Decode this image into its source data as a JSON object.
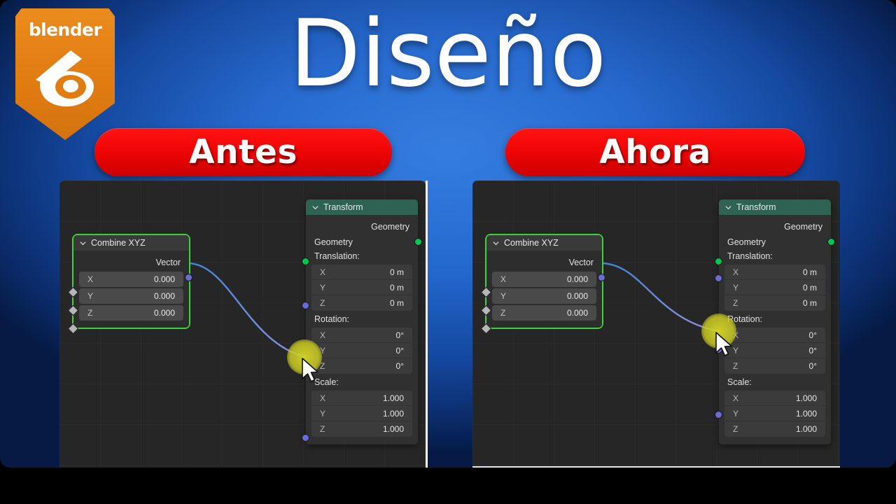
{
  "thumbnail": {
    "brand": "blender",
    "title": "Diseño",
    "background_color": "#1b62cc",
    "accent_color": "#f20606",
    "logo_color": "#e07c12"
  },
  "badges": {
    "left": "Antes",
    "right": "Ahora"
  },
  "panels": [
    {
      "id": "antes",
      "variant": "Antes",
      "nodes": {
        "combine_xyz": {
          "title": "Combine XYZ",
          "collapse_icon": "chevron-down-icon",
          "selected": true,
          "output": {
            "label": "Vector",
            "socket": "vector-socket",
            "color": "#6b6bd6"
          },
          "inputs": [
            {
              "key": "X",
              "value": "0.000",
              "socket": "diamond-socket"
            },
            {
              "key": "Y",
              "value": "0.000",
              "socket": "diamond-socket"
            },
            {
              "key": "Z",
              "value": "0.000",
              "socket": "diamond-socket"
            }
          ]
        },
        "transform": {
          "title": "Transform",
          "collapse_icon": "chevron-down-icon",
          "header_color": "#2e6353",
          "output": {
            "label": "Geometry",
            "socket": "geometry-socket",
            "color": "#00c64f"
          },
          "input_geometry": {
            "label": "Geometry",
            "socket": "geometry-socket",
            "color": "#00c64f"
          },
          "groups": [
            {
              "label": "Translation:",
              "socket_aligned_to_label": false,
              "fields": [
                {
                  "key": "X",
                  "value": "0 m"
                },
                {
                  "key": "Y",
                  "value": "0 m"
                },
                {
                  "key": "Z",
                  "value": "0 m"
                }
              ]
            },
            {
              "label": "Rotation:",
              "socket_aligned_to_label": false,
              "fields": [
                {
                  "key": "X",
                  "value": "0°"
                },
                {
                  "key": "Y",
                  "value": "0°"
                },
                {
                  "key": "Z",
                  "value": "0°"
                }
              ]
            },
            {
              "label": "Scale:",
              "socket_aligned_to_label": false,
              "fields": [
                {
                  "key": "X",
                  "value": "1.000"
                },
                {
                  "key": "Y",
                  "value": "1.000"
                },
                {
                  "key": "Z",
                  "value": "1.000"
                }
              ]
            }
          ]
        }
      },
      "link": {
        "from": "Vector",
        "to": "Rotation",
        "color_start": "#3f86d8",
        "color_end": "#8f8fd8"
      },
      "cursor": {
        "icon": "mouse-pointer-icon",
        "highlight_color": "#d6d628"
      }
    },
    {
      "id": "ahora",
      "variant": "Ahora",
      "nodes": {
        "combine_xyz": {
          "title": "Combine XYZ",
          "collapse_icon": "chevron-down-icon",
          "selected": true,
          "output": {
            "label": "Vector",
            "socket": "vector-socket",
            "color": "#6b6bd6"
          },
          "inputs": [
            {
              "key": "X",
              "value": "0.000",
              "socket": "diamond-socket"
            },
            {
              "key": "Y",
              "value": "0.000",
              "socket": "diamond-socket"
            },
            {
              "key": "Z",
              "value": "0.000",
              "socket": "diamond-socket"
            }
          ]
        },
        "transform": {
          "title": "Transform",
          "collapse_icon": "chevron-down-icon",
          "header_color": "#2e6353",
          "output": {
            "label": "Geometry",
            "socket": "geometry-socket",
            "color": "#00c64f"
          },
          "input_geometry": {
            "label": "Geometry",
            "socket": "geometry-socket",
            "color": "#00c64f"
          },
          "groups": [
            {
              "label": "Translation:",
              "socket_aligned_to_label": true,
              "fields": [
                {
                  "key": "X",
                  "value": "0 m"
                },
                {
                  "key": "Y",
                  "value": "0 m"
                },
                {
                  "key": "Z",
                  "value": "0 m"
                }
              ]
            },
            {
              "label": "Rotation:",
              "socket_aligned_to_label": true,
              "fields": [
                {
                  "key": "X",
                  "value": "0°"
                },
                {
                  "key": "Y",
                  "value": "0°"
                },
                {
                  "key": "Z",
                  "value": "0°"
                }
              ]
            },
            {
              "label": "Scale:",
              "socket_aligned_to_label": true,
              "fields": [
                {
                  "key": "X",
                  "value": "1.000"
                },
                {
                  "key": "Y",
                  "value": "1.000"
                },
                {
                  "key": "Z",
                  "value": "1.000"
                }
              ]
            }
          ]
        }
      },
      "link": {
        "from": "Vector",
        "to": "Rotation",
        "color_start": "#3f86d8",
        "color_end": "#8f8fd8"
      },
      "cursor": {
        "icon": "mouse-pointer-icon",
        "highlight_color": "#d6d628"
      }
    }
  ]
}
